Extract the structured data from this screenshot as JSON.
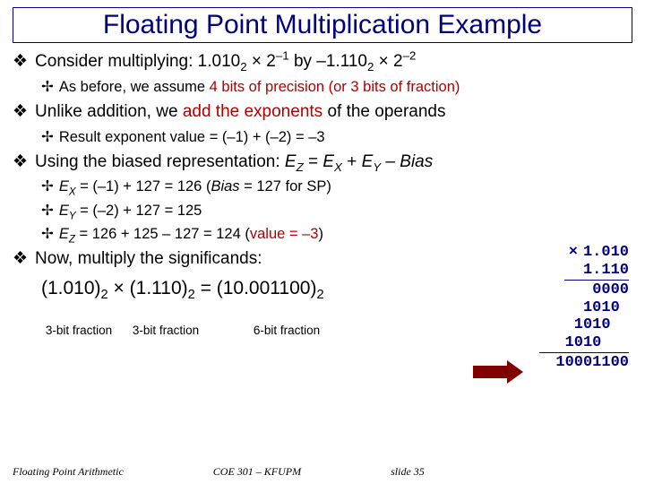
{
  "title": "Floating Point Multiplication Example",
  "bullets": {
    "b1_a_pre": "Consider multiplying: 1.010",
    "b1_a_sub1": "2",
    "b1_a_mid1": " × 2",
    "b1_a_sup1": "–1",
    "b1_a_mid2": " by –1.110",
    "b1_a_sub2": "2",
    "b1_a_mid3": " × 2",
    "b1_a_sup2": "–2",
    "b2_a_pre": "As before, we assume ",
    "b2_a_red": "4 bits of precision (or 3 bits of fraction)",
    "b1_b_pre": "Unlike addition, we ",
    "b1_b_red": "add the exponents ",
    "b1_b_post": "of the operands",
    "b2_b": "Result exponent value = (–1) + (–2) = –3",
    "b1_c_pre": "Using the biased representation: ",
    "b1_c_ez": "E",
    "b1_c_ezs": "Z",
    "b1_c_eq": " = ",
    "b1_c_ex": "E",
    "b1_c_exs": "X",
    "b1_c_plus": " + ",
    "b1_c_ey": "E",
    "b1_c_eys": "Y",
    "b1_c_min": " – ",
    "b1_c_bias": "Bias",
    "b2_c1_e": "E",
    "b2_c1_sub": "X",
    "b2_c1_rest": " = (–1) + 127 = 126 (",
    "b2_c1_bias": "Bias",
    "b2_c1_tail": " = 127 for SP)",
    "b2_c2_e": "E",
    "b2_c2_sub": "Y",
    "b2_c2_rest": " = (–2) + 127 = 125",
    "b2_c3_e": "E",
    "b2_c3_sub": "Z",
    "b2_c3_rest": " = 126 + 125 – 127 = 124 (",
    "b2_c3_red": "value = –3",
    "b2_c3_tail": ")",
    "b1_d": "Now, multiply the significands:"
  },
  "sig": {
    "a": "(1.010)",
    "as": "2",
    "x": " × ",
    "b": "(1.110)",
    "bs": "2",
    "eq": " = ",
    "c": "(10.001100)",
    "cs": "2"
  },
  "frac": {
    "l1": "3-bit fraction",
    "l2": "3-bit fraction",
    "l3": "6-bit fraction"
  },
  "mult": {
    "op1": "1.010",
    "op2": "1.110",
    "p1": "0000",
    "p2": "1010 ",
    "p3": "1010  ",
    "p4": "1010   ",
    "res": "10001100",
    "x": "×"
  },
  "footer": {
    "a": "Floating Point Arithmetic",
    "b": "COE 301 – KFUPM",
    "c": "slide 35"
  },
  "glyph": {
    "diamond": "❖",
    "cross": "✢"
  }
}
